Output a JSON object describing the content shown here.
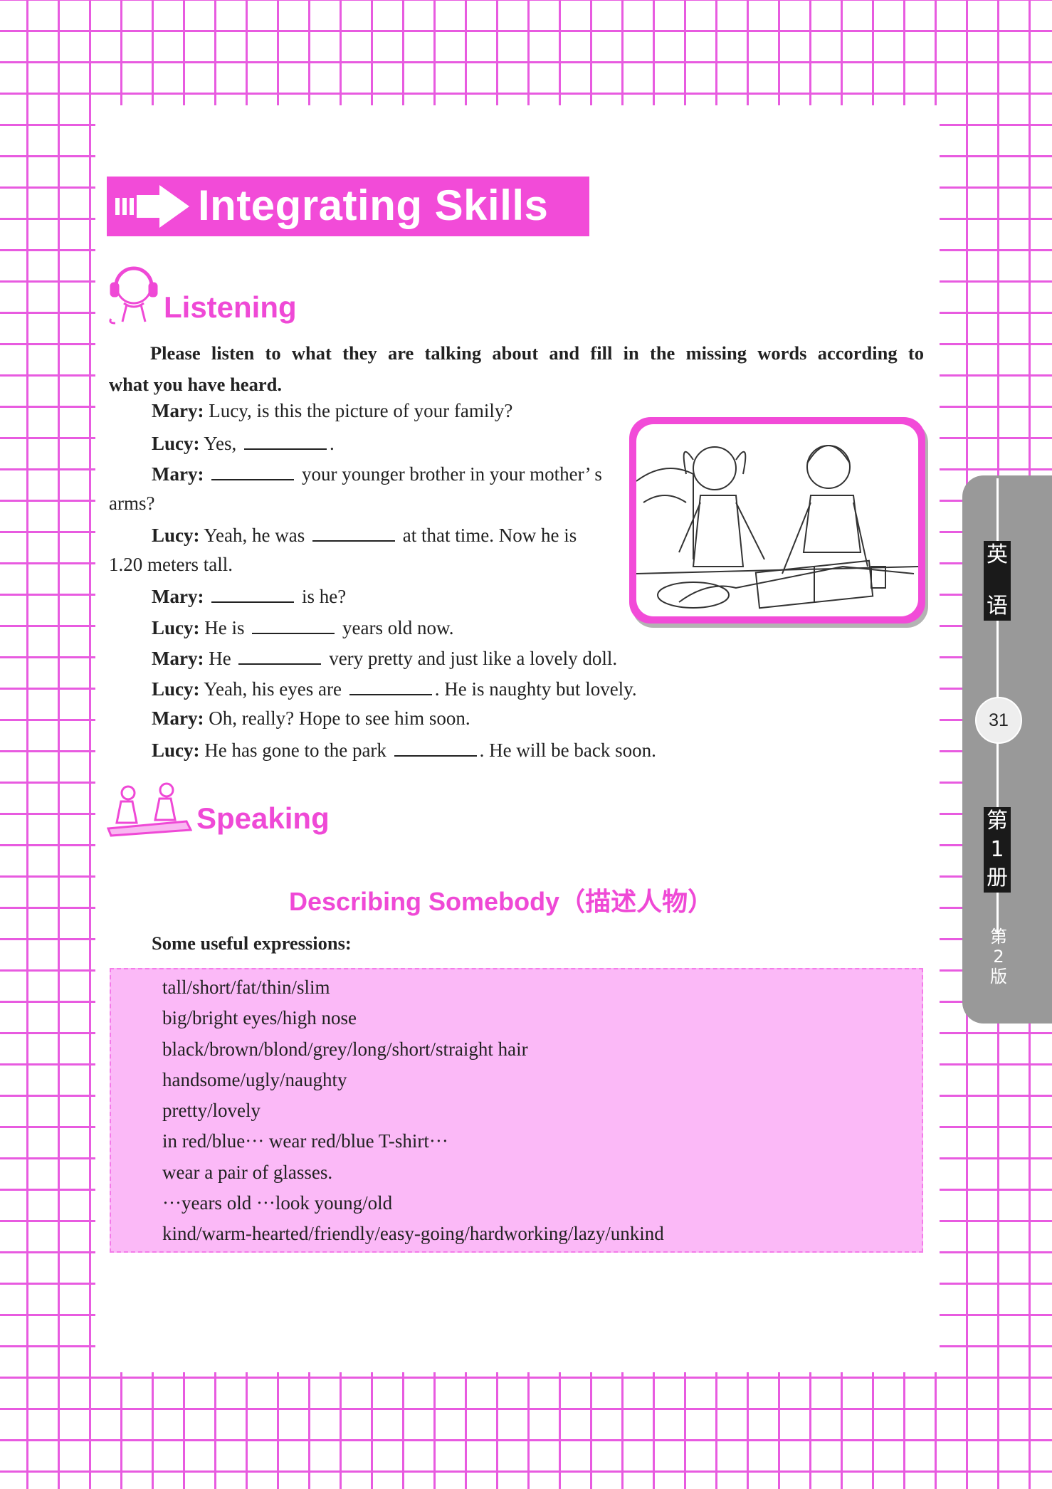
{
  "header": {
    "title": "Integrating Skills"
  },
  "listening": {
    "heading": "Listening",
    "instruction_line1": "Please listen to what they are talking about and fill in the missing words according to",
    "instruction_line2": "what you have heard.",
    "dialogue": [
      {
        "speaker": "Mary:",
        "before": " Lucy, is this the picture of your family?"
      },
      {
        "speaker": "Lucy:",
        "before": " Yes, ",
        "after": "."
      },
      {
        "speaker": "Mary:",
        "before": " ",
        "after": " your younger brother in your mother’ s"
      },
      {
        "cont": "arms?"
      },
      {
        "speaker": "Lucy:",
        "before": " Yeah, he was ",
        "after": " at that time. Now he is"
      },
      {
        "cont": "1.20 meters tall."
      },
      {
        "speaker": "Mary:",
        "before": " ",
        "after": " is he?"
      },
      {
        "speaker": "Lucy:",
        "before": " He is ",
        "after": " years old now."
      },
      {
        "speaker": "Mary:",
        "before": " He ",
        "after": " very pretty and just like a lovely doll."
      },
      {
        "speaker": "Lucy:",
        "before": " Yeah, his eyes are ",
        "after": ". He is naughty but lovely."
      },
      {
        "speaker": "Mary:",
        "before": " Oh, really? Hope to see him soon."
      },
      {
        "speaker": "Lucy:",
        "before": " He has gone to the park ",
        "after": ". He will be back soon."
      }
    ]
  },
  "speaking": {
    "heading": "Speaking",
    "subheading": "Describing Somebody（描述人物）",
    "useful_label": "Some useful expressions:",
    "expressions": [
      "tall/short/fat/thin/slim",
      "big/bright eyes/high nose",
      "black/brown/blond/grey/long/short/straight hair",
      "handsome/ugly/naughty",
      "pretty/lovely",
      "in red/blue···   wear red/blue T-shirt···",
      "wear a pair of glasses.",
      "···years old   ···look young/old",
      "kind/warm-hearted/friendly/easy-going/hardworking/lazy/unkind"
    ]
  },
  "side_tab": {
    "subject": [
      "英",
      "语"
    ],
    "page": "31",
    "volume": [
      "第",
      "1",
      "册"
    ],
    "edition": [
      "（",
      "第",
      "2",
      "版",
      "）"
    ]
  },
  "colors": {
    "accent": "#f24bd8",
    "grid": "#e85be0",
    "box": "#fbb9f7",
    "tab": "#999999"
  },
  "icons": [
    "arrow-icon",
    "headset-kid-icon",
    "two-people-talking-icon"
  ]
}
